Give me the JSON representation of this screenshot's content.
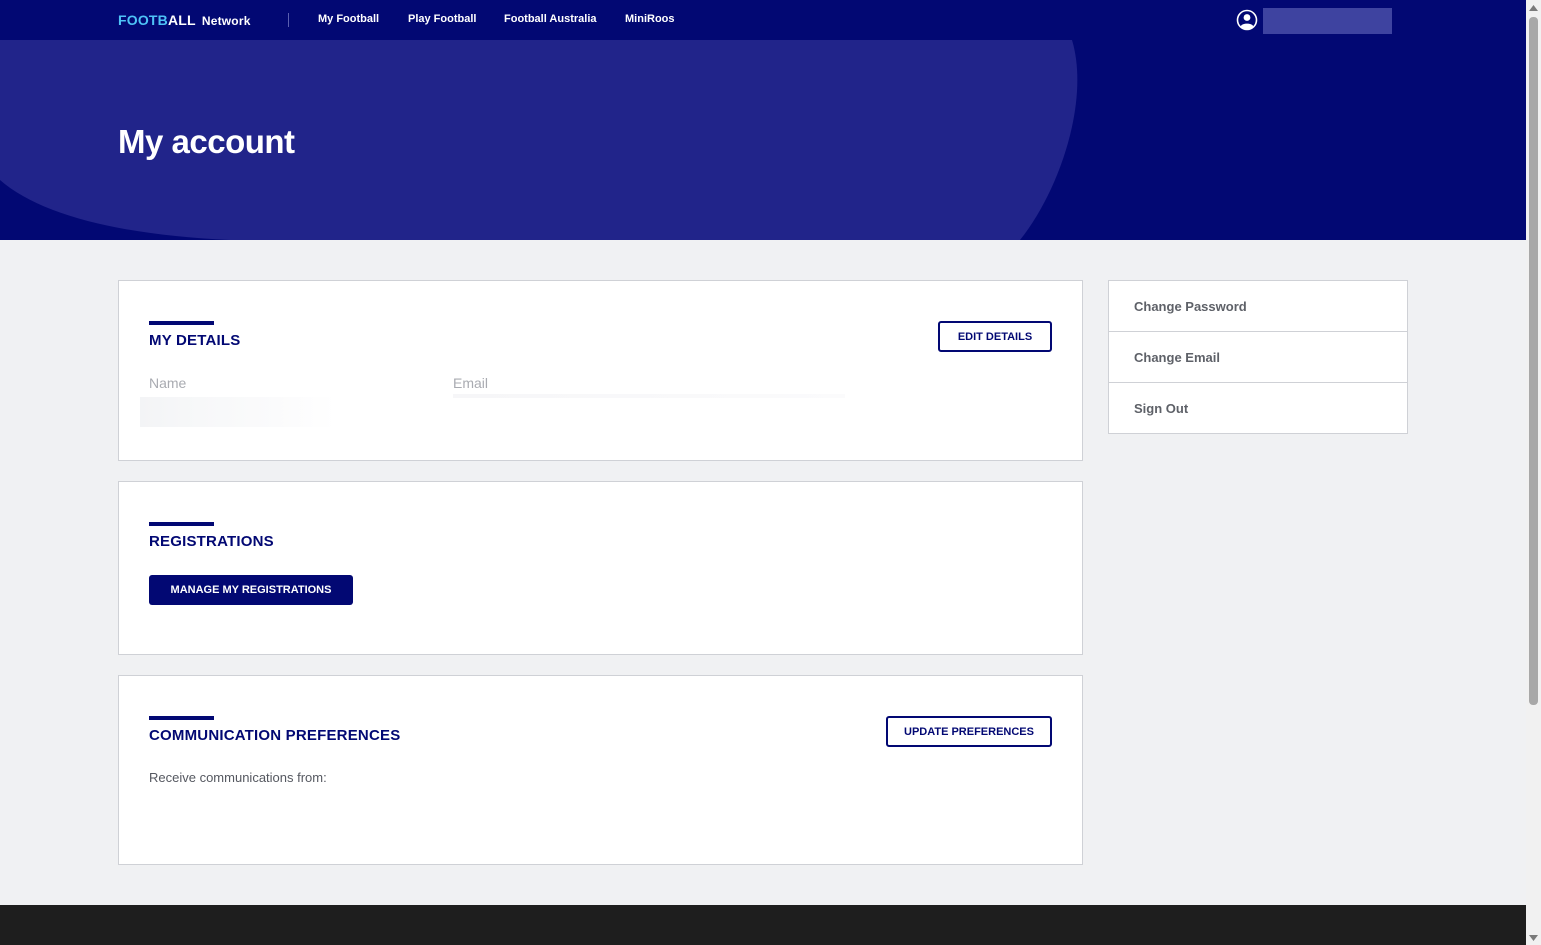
{
  "nav": {
    "logo_part1": "FOOTB",
    "logo_part2": "ALL",
    "logo_part3": "Network",
    "links": [
      "My Football",
      "Play Football",
      "Football Australia",
      "MiniRoos"
    ]
  },
  "hero": {
    "title": "My account"
  },
  "details": {
    "title": "MY DETAILS",
    "edit_label": "EDIT DETAILS",
    "name_label": "Name",
    "email_label": "Email"
  },
  "registrations": {
    "title": "REGISTRATIONS",
    "manage_label": "MANAGE MY REGISTRATIONS"
  },
  "communication": {
    "title": "COMMUNICATION PREFERENCES",
    "update_label": "UPDATE PREFERENCES",
    "receive_text": "Receive communications from:"
  },
  "side_menu": {
    "items": [
      "Change Password",
      "Change Email",
      "Sign Out"
    ]
  },
  "colors": {
    "brand_navy": "#020873",
    "logo_accent": "#4ec3f7",
    "page_bg": "#f0f1f3",
    "footer_bg": "#1e1e1e"
  },
  "icons": {
    "user": "user-circle-icon"
  }
}
